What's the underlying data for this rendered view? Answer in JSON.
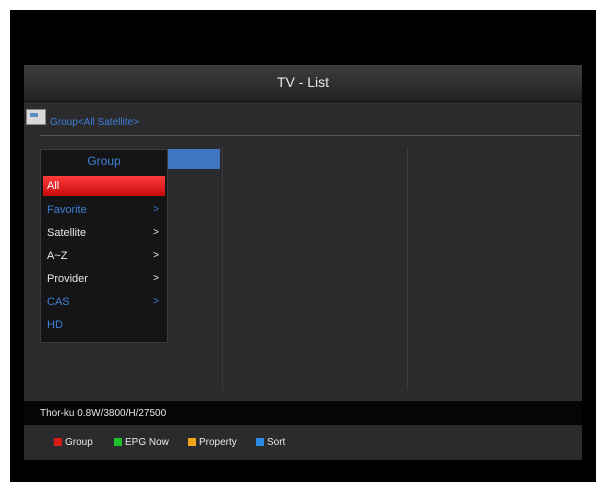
{
  "window": {
    "title": "TV - List"
  },
  "group_path": "Group<All Satellite>",
  "group_panel": {
    "title": "Group",
    "items": [
      {
        "label": "All",
        "arrow": "",
        "state": "selected"
      },
      {
        "label": "Favorite",
        "arrow": ">",
        "state": "dim"
      },
      {
        "label": "Satellite",
        "arrow": ">",
        "state": "normal"
      },
      {
        "label": "A~Z",
        "arrow": ">",
        "state": "normal"
      },
      {
        "label": "Provider",
        "arrow": ">",
        "state": "normal"
      },
      {
        "label": "CAS",
        "arrow": ">",
        "state": "dim"
      },
      {
        "label": "HD",
        "arrow": "",
        "state": "dim"
      }
    ]
  },
  "status": {
    "transponder": "Thor-ku 0.8W/3800/H/27500"
  },
  "footer": {
    "keys": [
      {
        "label": "Group",
        "color": "#d81b1b"
      },
      {
        "label": "EPG Now",
        "color": "#1fbf2a"
      },
      {
        "label": "Property",
        "color": "#f2a51a"
      },
      {
        "label": "Sort",
        "color": "#2a8be2"
      }
    ]
  },
  "colors": {
    "accent_blue": "#3e7fd6",
    "selection_red": "#e01212",
    "panel_bg": "#2b2b2d"
  }
}
